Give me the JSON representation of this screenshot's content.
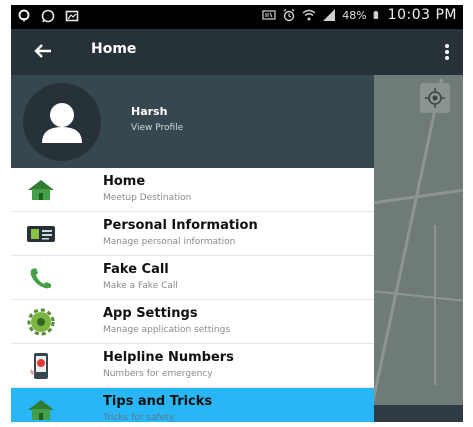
{
  "status_bar": {
    "time": "10:03 PM",
    "battery": "48%",
    "left_icons": [
      "location-icon",
      "whatsapp-icon",
      "gallery-icon"
    ],
    "right_icons": [
      "nfc-icon",
      "alarm-icon",
      "wifi-icon",
      "signal-icon",
      "battery-icon"
    ]
  },
  "app_bar": {
    "title": "Home",
    "back_icon": "arrow-back-icon",
    "menu_icon": "overflow-menu-icon",
    "background": "#263238"
  },
  "profile": {
    "name": "Harsh",
    "link": "View Profile",
    "background": "#37474f"
  },
  "menu": {
    "items": [
      {
        "title": "Home",
        "subtitle": "Meetup Destination",
        "icon": "home-icon"
      },
      {
        "title": "Personal Information",
        "subtitle": "Manage personal information",
        "icon": "id-card-icon"
      },
      {
        "title": "Fake Call",
        "subtitle": "Make a Fake Call",
        "icon": "phone-icon"
      },
      {
        "title": "App Settings",
        "subtitle": "Manage application settings",
        "icon": "gear-icon"
      },
      {
        "title": "Helpline Numbers",
        "subtitle": "Numbers for emergency",
        "icon": "helpline-phone-icon"
      },
      {
        "title": "Tips and Tricks",
        "subtitle": "Tricks for safety",
        "icon": "home-icon",
        "active": true
      }
    ],
    "active_color": "#29b6f6"
  }
}
